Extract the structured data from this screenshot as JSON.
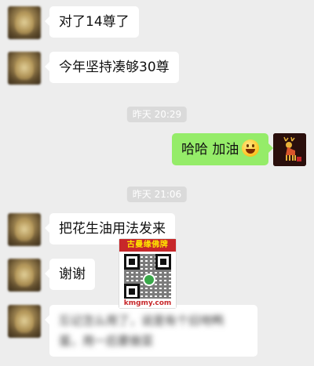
{
  "messages": [
    {
      "side": "left",
      "text": "对了14尊了"
    },
    {
      "side": "left",
      "text": "今年坚持凑够30尊"
    },
    {
      "side": "right",
      "text": "哈哈 加油",
      "emoji": "smile-emoji-icon"
    },
    {
      "side": "left",
      "text": "把花生油用法发来"
    },
    {
      "side": "left",
      "text": "谢谢"
    },
    {
      "side": "left",
      "line1": "忘记怎么用了，说是有个旧地鸭",
      "line2": "蛋，用一后要做菜"
    }
  ],
  "timestamps": [
    "昨天 20:29",
    "昨天 21:06"
  ],
  "watermark": {
    "header": "古曼缘佛牌",
    "footer": "kmgmy.com"
  },
  "colors": {
    "background": "#ededed",
    "incoming_bubble": "#ffffff",
    "outgoing_bubble": "#95ec69",
    "watermark_red": "#c7272a"
  }
}
